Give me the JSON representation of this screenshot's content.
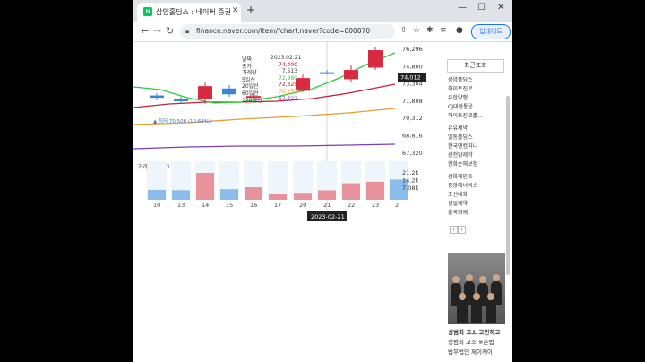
{
  "browser": {
    "tab_title": "삼양홀딩스 : 네이버 증권",
    "tab_close": "✕",
    "new_tab": "+",
    "url": "finance.naver.com/item/fchart.naver?code=000070",
    "update_label": "업데이트"
  },
  "info_panel": {
    "rows": [
      {
        "label": "날짜",
        "value": "2023.02.21",
        "color": "#333333"
      },
      {
        "label": "종가",
        "value": "74,400",
        "color": "#d0021b"
      },
      {
        "label": "거래량",
        "value": "7,513",
        "color": "#333333"
      },
      {
        "label": "5일선",
        "value": "72,980",
        "color": "#2ecc40"
      },
      {
        "label": "20일선",
        "value": "72,325",
        "color": "#d0021b"
      },
      {
        "label": "60일선",
        "value": "70,350",
        "color": "#e0a030"
      },
      {
        "label": "120일선",
        "value": "67,722",
        "color": "#7b3fb5"
      }
    ]
  },
  "chart_data": {
    "type": "candlestick",
    "x": [
      "10",
      "13",
      "14",
      "15",
      "16",
      "17",
      "20",
      "21",
      "22",
      "23",
      "2"
    ],
    "price_axis": [
      "76,296",
      "74,800",
      "73,304",
      "71,808",
      "70,312",
      "68,816",
      "67,320"
    ],
    "current_price_tag": "74,012",
    "low_annotation": "▲ 최저 70,500 (10.64%)",
    "volume_label": "거래량",
    "volume_value": "7,513",
    "volume_axis": [
      "21.2k",
      "14.2k",
      "7.08k"
    ],
    "crosshair_date": "2023-02-21",
    "candles": [
      {
        "x": "10",
        "open": 72400,
        "close": 72200,
        "high": 72600,
        "low": 72000,
        "dir": "down"
      },
      {
        "x": "13",
        "open": 72100,
        "close": 71900,
        "high": 72300,
        "low": 71700,
        "dir": "down"
      },
      {
        "x": "14",
        "open": 72100,
        "close": 73200,
        "high": 73500,
        "low": 71700,
        "dir": "up"
      },
      {
        "x": "15",
        "open": 73000,
        "close": 72500,
        "high": 73300,
        "low": 72300,
        "dir": "down"
      },
      {
        "x": "16",
        "open": 72300,
        "close": 72350,
        "high": 72600,
        "low": 72200,
        "dir": "up"
      },
      {
        "x": "20",
        "open": 72800,
        "close": 73900,
        "high": 74200,
        "low": 72700,
        "dir": "up"
      },
      {
        "x": "21",
        "open": 74400,
        "close": 74400,
        "high": 74600,
        "low": 74200,
        "dir": "down"
      },
      {
        "x": "22",
        "open": 73800,
        "close": 74600,
        "high": 75000,
        "low": 73600,
        "dir": "up"
      },
      {
        "x": "23",
        "open": 74800,
        "close": 76300,
        "high": 76600,
        "low": 74600,
        "dir": "up"
      }
    ],
    "volumes": [
      {
        "x": "10",
        "v": 7800,
        "dir": "down"
      },
      {
        "x": "13",
        "v": 7600,
        "dir": "down"
      },
      {
        "x": "14",
        "v": 21200,
        "dir": "up"
      },
      {
        "x": "15",
        "v": 8400,
        "dir": "down"
      },
      {
        "x": "16",
        "v": 9900,
        "dir": "up"
      },
      {
        "x": "17",
        "v": 4300,
        "dir": "up"
      },
      {
        "x": "20",
        "v": 5500,
        "dir": "up"
      },
      {
        "x": "21",
        "v": 7513,
        "dir": "up"
      },
      {
        "x": "22",
        "v": 13000,
        "dir": "up"
      },
      {
        "x": "23",
        "v": 14200,
        "dir": "up"
      },
      {
        "x": "2",
        "v": 16000,
        "dir": "down"
      }
    ],
    "colors": {
      "up": "#d82a40",
      "down": "#3a86d6",
      "ma5": "#2ecc40",
      "ma20": "#c0243a",
      "ma60": "#e0a030",
      "ma120": "#7b3fb5",
      "vol_up": "#e8939c",
      "vol_down": "#8cbcec"
    }
  },
  "sidebar": {
    "recent_title": "최근조회",
    "items": [
      "삼양홀딩스",
      "하이트진로",
      "유한양행",
      "CJ대한통운",
      "하이트진로홀…",
      "유유제약",
      "일동홀딩스",
      "한국앤컴퍼니",
      "삼천당제약",
      "한화손해보험",
      "삼화페인트",
      "중앙에너비스",
      "조선내화",
      "삼일제약",
      "흥국화재"
    ],
    "prev": "‹",
    "next": "›",
    "ad_line1": "성범죄 고소 고민하고",
    "ad_line2": "성범죄 고소 ※준법",
    "ad_line3": "법무법인 제이케이"
  }
}
